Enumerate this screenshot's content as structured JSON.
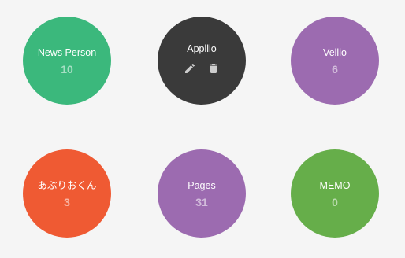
{
  "apps": [
    {
      "name": "News Person",
      "count": "10",
      "color": "#3bb87c"
    },
    {
      "name": "Appllio",
      "color": "#3a3a3a",
      "actions": [
        {
          "icon": "pencil-icon"
        },
        {
          "icon": "trash-icon"
        }
      ]
    },
    {
      "name": "Vellio",
      "count": "6",
      "color": "#9c6bb0"
    },
    {
      "name": "あぶりおくん",
      "count": "3",
      "color": "#ef5a33"
    },
    {
      "name": "Pages",
      "count": "31",
      "color": "#9c6bb0"
    },
    {
      "name": "MEMO",
      "count": "0",
      "color": "#66ae4a"
    }
  ]
}
